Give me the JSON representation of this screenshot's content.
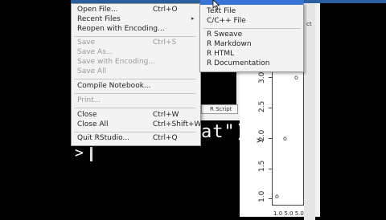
{
  "file_menu": {
    "items": [
      {
        "label": "Open File...",
        "shortcut": "Ctrl+O",
        "disabled": false
      },
      {
        "label": "Recent Files",
        "shortcut": "",
        "submenu": true,
        "disabled": false
      },
      {
        "label": "Reopen with Encoding...",
        "shortcut": "",
        "disabled": false
      },
      {
        "label": "Save",
        "shortcut": "Ctrl+S",
        "disabled": true
      },
      {
        "label": "Save As...",
        "shortcut": "",
        "disabled": true
      },
      {
        "label": "Save with Encoding...",
        "shortcut": "",
        "disabled": true
      },
      {
        "label": "Save All",
        "shortcut": "",
        "disabled": true
      },
      {
        "label": "Compile Notebook...",
        "shortcut": "",
        "disabled": false
      },
      {
        "label": "Print...",
        "shortcut": "",
        "disabled": true
      },
      {
        "label": "Close",
        "shortcut": "Ctrl+W",
        "disabled": false
      },
      {
        "label": "Close All",
        "shortcut": "Ctrl+Shift+W",
        "disabled": false
      },
      {
        "label": "Quit RStudio...",
        "shortcut": "Ctrl+Q",
        "disabled": false
      }
    ]
  },
  "new_file_submenu": {
    "items": [
      "Text File",
      "C/C++ File",
      "R Sweave",
      "R Markdown",
      "R HTML",
      "R Documentation"
    ]
  },
  "editor": {
    "script_tab": "R Script"
  },
  "console": {
    "text_fragment": "at\")",
    "prompt": ">"
  },
  "plot": {
    "y_axis_label": "y",
    "y_ticks": [
      "3.0",
      "2.5",
      "2.0",
      "1.5",
      "1.0"
    ],
    "x_ticks": "1.0 5.0 5.0"
  },
  "right_panel": {
    "label": "ct"
  },
  "colors": {
    "highlight": "#3875d7",
    "menu_bg": "#f3f3f3",
    "console_bg": "#000000"
  }
}
